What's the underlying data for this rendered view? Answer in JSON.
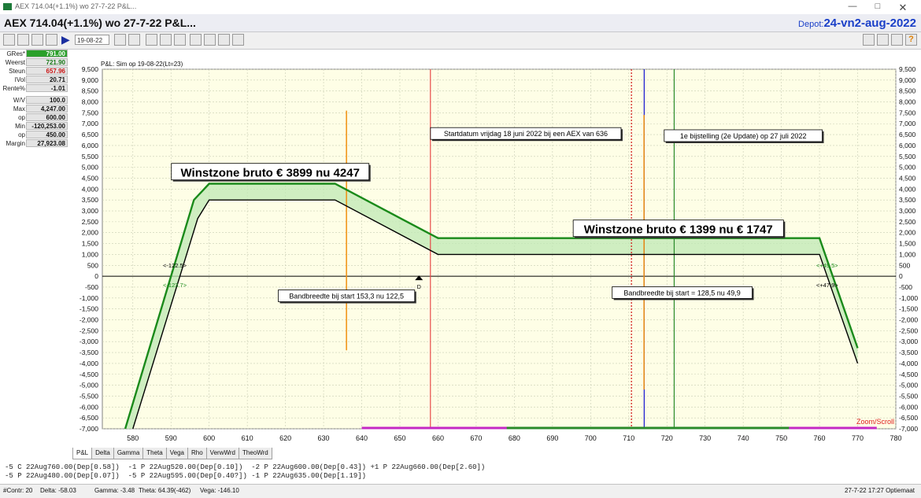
{
  "window": {
    "title": "AEX 714.04(+1.1%)  wo 27-7-22  P&L...",
    "minimize": "—",
    "maximize": "□",
    "close": "✕"
  },
  "header": {
    "title": "AEX 714.04(+1.1%)  wo 27-7-22  P&L...",
    "depot_label": "Depot:",
    "depot_value": "24-vn2-aug-2022"
  },
  "toolbar": {
    "date_value": "19-08-22",
    "icons": [
      "calendar-icon",
      "table-icon",
      "grid-icon",
      "list-icon",
      "play-icon",
      "left-arrow-icon",
      "close-icon",
      "cursor-icon",
      "crosshair-icon",
      "zoom-icon",
      "chart-icon",
      "line-icon",
      "pen-icon",
      "bar-chart-icon"
    ],
    "right_icons": [
      "print-icon",
      "camera-icon",
      "settings-icon",
      "help-icon"
    ]
  },
  "side_panel": [
    {
      "label": "GRes*",
      "value": "791.00",
      "bg": "#2aa02a",
      "fg": "#ffffff"
    },
    {
      "label": "Weerst",
      "value": "721.90",
      "bg": "#e4e4e4",
      "fg": "#1a7a1a"
    },
    {
      "label": "Steun",
      "value": "657.96",
      "bg": "#e4e4e4",
      "fg": "#c81414"
    },
    {
      "label": "IVol",
      "value": "20.71",
      "bg": "#e4e4e4",
      "fg": "#111111"
    },
    {
      "label": "Rente%",
      "value": "-1.01",
      "bg": "#e4e4e4",
      "fg": "#111111"
    },
    {
      "label": "W/V",
      "value": "100.0",
      "bg": "#e4e4e4",
      "fg": "#111111"
    },
    {
      "label": "Max",
      "value": "4,247.00",
      "bg": "#e4e4e4",
      "fg": "#111111"
    },
    {
      "label": "op",
      "value": "600.00",
      "bg": "#e4e4e4",
      "fg": "#111111"
    },
    {
      "label": "Min",
      "value": "-120,253.00",
      "bg": "#e4e4e4",
      "fg": "#111111"
    },
    {
      "label": "op",
      "value": "450.00",
      "bg": "#e4e4e4",
      "fg": "#111111"
    },
    {
      "label": "Margin",
      "value": "27,923.08",
      "bg": "#e4e4e4",
      "fg": "#111111"
    }
  ],
  "chart_data": {
    "type": "line",
    "title": "P&L:  Sim op 19-08-22(Lt=23)",
    "xlim": [
      572,
      780
    ],
    "ylim": [
      -7000,
      9500
    ],
    "x_ticks": [
      580,
      590,
      600,
      610,
      620,
      630,
      640,
      650,
      660,
      670,
      680,
      690,
      700,
      710,
      720,
      730,
      740,
      750,
      760,
      770,
      780
    ],
    "y_ticks": [
      9500,
      9000,
      8500,
      8000,
      7500,
      7000,
      6500,
      6000,
      5500,
      5000,
      4500,
      4000,
      3500,
      3000,
      2500,
      2000,
      1500,
      1000,
      500,
      0,
      -500,
      -1000,
      -1500,
      -2000,
      -2500,
      -3000,
      -3500,
      -4000,
      -4500,
      -5000,
      -5500,
      -6000,
      -6500,
      -7000
    ],
    "grid": true,
    "series": [
      {
        "color": "#1a8a1a",
        "x": [
          578,
          596,
          600,
          633,
          660,
          760,
          770
        ],
        "y": [
          -7000,
          3500,
          4247,
          4247,
          1747,
          1747,
          -3300
        ]
      },
      {
        "color": "#000000",
        "x": [
          580,
          597,
          600,
          633,
          660,
          760,
          770
        ],
        "y": [
          -7000,
          2650,
          3500,
          3500,
          1000,
          1000,
          -4000
        ]
      }
    ],
    "vertical_lines": [
      {
        "x": 658,
        "color": "#e84a4a",
        "style": "solid"
      },
      {
        "x": 710.7,
        "color": "#d01010",
        "style": "dotted"
      },
      {
        "x": 714.04,
        "color": "#1515d0",
        "style": "solid"
      },
      {
        "x": 721.9,
        "color": "#2a8a2a",
        "style": "solid"
      }
    ],
    "orange_lines": [
      {
        "x": 636,
        "y1": -3400,
        "y2": 7600
      },
      {
        "x": 714,
        "y1": -5200,
        "y2": 7400
      }
    ],
    "annotations": [
      {
        "text": "Winstzone bruto € 3899 nu 4247",
        "x": 616,
        "y": 4800,
        "big": true
      },
      {
        "text": "Winstzone bruto € 1399 nu € 1747",
        "x": 723,
        "y": 2200,
        "big": true
      },
      {
        "text": "Startdatum vrijdag 18 juni 2022 bij een AEX van 636",
        "x": 683,
        "y": 6550
      },
      {
        "text": "1e bijstelling (2e Update) op 27 juli 2022",
        "x": 740,
        "y": 6450
      },
      {
        "text": "Bandbreedte bij start 153,3 nu 122,5",
        "x": 636,
        "y": -900
      },
      {
        "text": "Bandbreedte bij start = 128,5 nu 49,9",
        "x": 724,
        "y": -750
      }
    ],
    "markers": [
      {
        "text": "<-122.5>",
        "x": 591,
        "y": 400,
        "color": "#000000"
      },
      {
        "text": "<-123.7>",
        "x": 591,
        "y": -500,
        "color": "#1a8a1a"
      },
      {
        "text": "<+49.5>",
        "x": 762,
        "y": 400,
        "color": "#1a8a1a"
      },
      {
        "text": "<+47.9>",
        "x": 762,
        "y": -500,
        "color": "#000000"
      },
      {
        "text": "D",
        "x": 655,
        "y": -430,
        "color": "#000000"
      }
    ],
    "bottom_bars": [
      {
        "x1": 640,
        "x2": 775,
        "color": "#c428c4"
      },
      {
        "x1": 678,
        "x2": 752,
        "color": "#2a8a2a"
      }
    ],
    "zoom_label": "Zoom/Scroll"
  },
  "tabs": [
    "P&L",
    "Delta",
    "Gamma",
    "Theta",
    "Vega",
    "Rho",
    "VerwWrd",
    "TheoWrd"
  ],
  "legs": [
    "-5 C 22Aug760.00(Dep[0.58])  -1 P 22Aug520.00(Dep[0.10])  -2 P 22Aug600.00(Dep[0.43]) +1 P 22Aug660.00(Dep[2.60])",
    "-5 P 22Aug480.00(Dep[0.07])  -5 P 22Aug595.00(Dep[0.40?]) -1 P 22Aug635.00(Dep[1.19])"
  ],
  "status": {
    "contr": "#Contr: 20",
    "delta": "Delta: -58.03",
    "gamma": "Gamma: -3.48",
    "theta": "Theta: 64.39(-462)",
    "vega": "Vega: -146.10",
    "right": "27-7-22 17:27 Optiemaat"
  }
}
